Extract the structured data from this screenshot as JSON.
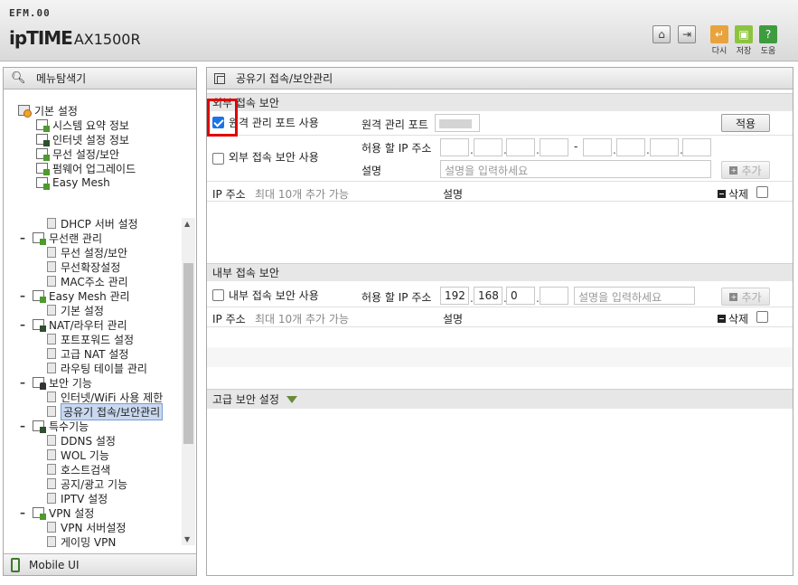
{
  "header": {
    "small_brand": "EFM.00",
    "brand_name": "ipTIME",
    "model": "AX1500R",
    "buttons": [
      {
        "icon": "home-icon"
      },
      {
        "icon": "logout-icon"
      },
      {
        "icon": "refresh-icon",
        "label": "다시"
      },
      {
        "icon": "save-icon",
        "label": "저장"
      },
      {
        "icon": "help-icon",
        "label": "도움"
      }
    ],
    "colors": {
      "refresh": "#e8a33c",
      "save": "#8cc43e",
      "help": "#3e9b3e"
    }
  },
  "nav": {
    "title": "메뉴탐색기",
    "top_items": [
      {
        "label": "기본 설정"
      },
      {
        "label": "시스템 요약 정보"
      },
      {
        "label": "인터넷 설정 정보"
      },
      {
        "label": "무선 설정/보안"
      },
      {
        "label": "펌웨어 업그레이드"
      },
      {
        "label": "Easy Mesh"
      }
    ],
    "tree": [
      {
        "label": "DHCP 서버 설정"
      },
      {
        "label": "무선랜 관리"
      },
      {
        "label": "무선 설정/보안"
      },
      {
        "label": "무선확장설정"
      },
      {
        "label": "MAC주소 관리"
      },
      {
        "label": "Easy Mesh 관리"
      },
      {
        "label": "기본 설정"
      },
      {
        "label": "NAT/라우터 관리"
      },
      {
        "label": "포트포워드 설정"
      },
      {
        "label": "고급 NAT 설정"
      },
      {
        "label": "라우팅 테이블 관리"
      },
      {
        "label": "보안 기능"
      },
      {
        "label": "인터넷/WiFi 사용 제한"
      },
      {
        "label": "공유기 접속/보안관리"
      },
      {
        "label": "특수기능"
      },
      {
        "label": "DDNS 설정"
      },
      {
        "label": "WOL 기능"
      },
      {
        "label": "호스트검색"
      },
      {
        "label": "공지/광고 기능"
      },
      {
        "label": "IPTV 설정"
      },
      {
        "label": "VPN 설정"
      },
      {
        "label": "VPN 서버설정"
      },
      {
        "label": "게이밍 VPN"
      }
    ],
    "footer": "Mobile UI"
  },
  "main": {
    "title": "공유기 접속/보안관리",
    "external": {
      "section_title": "외부 접속 보안",
      "remote_port_checkbox_label": "원격 관리 포트 사용",
      "remote_port_checked": true,
      "remote_port_label": "원격 관리 포트",
      "apply_button": "적용",
      "ext_security_label": "외부 접속 보안 사용",
      "ext_security_checked": false,
      "allowed_ip_label": "허용 할 IP 주소",
      "ip_dash": "-",
      "desc_label": "설명",
      "desc_placeholder": "설명을 입력하세요",
      "add_button": "추가",
      "table_ip_header": "IP 주소",
      "table_ip_note": "최대 10개 추가 가능",
      "table_desc_header": "설명",
      "delete_label": "삭제"
    },
    "internal": {
      "section_title": "내부 접속 보안",
      "int_security_label": "내부 접속 보안 사용",
      "int_security_checked": false,
      "allowed_ip_label": "허용 할 IP 주소",
      "ip": [
        "192",
        "168",
        "0",
        ""
      ],
      "desc_placeholder": "설명을 입력하세요",
      "add_button": "추가",
      "table_ip_header": "IP 주소",
      "table_ip_note": "최대 10개 추가 가능",
      "table_desc_header": "설명",
      "delete_label": "삭제"
    },
    "advanced": {
      "section_title": "고급 보안 설정"
    }
  }
}
